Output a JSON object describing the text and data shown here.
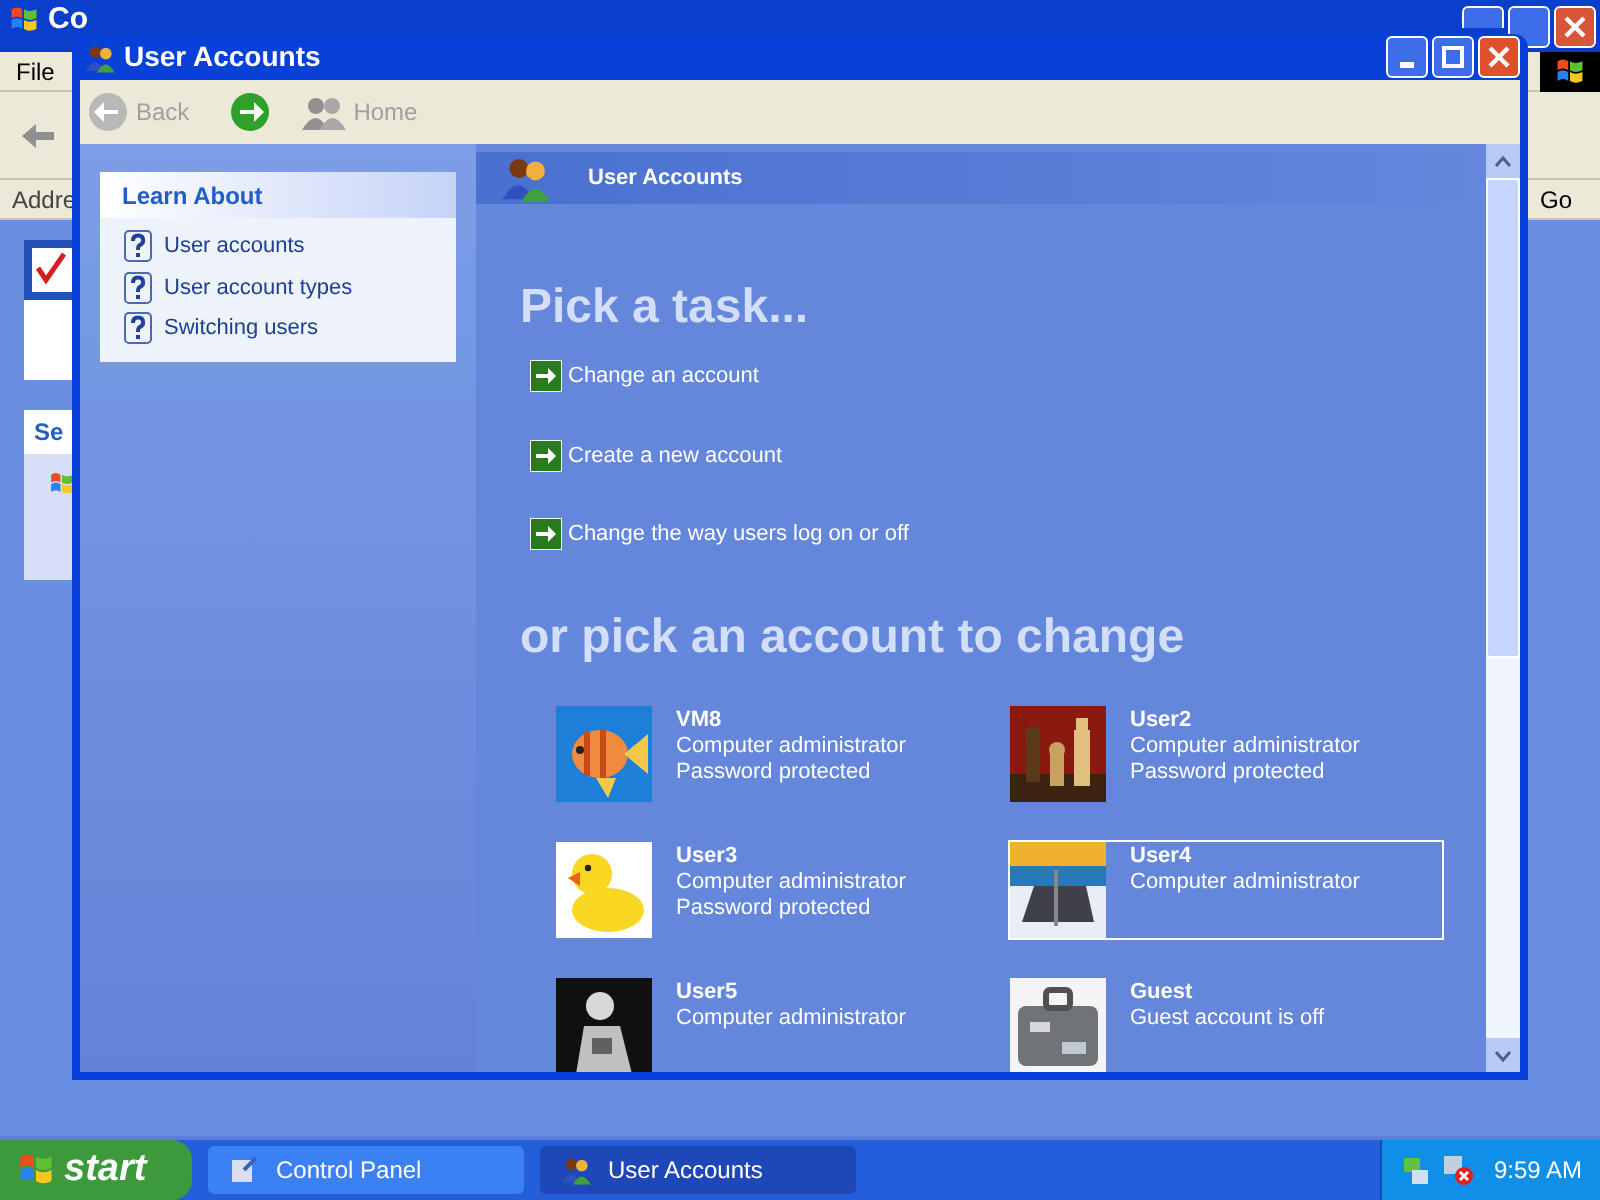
{
  "background_window": {
    "title": "Co",
    "menu": [
      "File"
    ],
    "address_label": "Addre",
    "go_button": "Go",
    "task_pane_title": "Se"
  },
  "window": {
    "title": "User Accounts"
  },
  "toolbar": {
    "back": "Back",
    "home": "Home"
  },
  "learn_about": {
    "title": "Learn About",
    "items": [
      "User accounts",
      "User account types",
      "Switching users"
    ]
  },
  "header": {
    "title": "User Accounts"
  },
  "tasks_heading": "Pick a task...",
  "tasks": [
    "Change an account",
    "Create a new account",
    "Change the way users log on or off"
  ],
  "accounts_heading": "or pick an account to change",
  "accounts": [
    {
      "name": "VM8",
      "lines": [
        "Computer administrator",
        "Password protected"
      ],
      "selected": false
    },
    {
      "name": "User2",
      "lines": [
        "Computer administrator",
        "Password protected"
      ],
      "selected": false
    },
    {
      "name": "User3",
      "lines": [
        "Computer administrator",
        "Password protected"
      ],
      "selected": false
    },
    {
      "name": "User4",
      "lines": [
        "Computer administrator"
      ],
      "selected": true
    },
    {
      "name": "User5",
      "lines": [
        "Computer administrator"
      ],
      "selected": false
    },
    {
      "name": "Guest",
      "lines": [
        "Guest account is off"
      ],
      "selected": false
    }
  ],
  "taskbar": {
    "start": "start",
    "items": [
      {
        "label": "Control Panel",
        "selected": false
      },
      {
        "label": "User Accounts",
        "selected": true
      }
    ],
    "clock": "9:59 AM"
  }
}
